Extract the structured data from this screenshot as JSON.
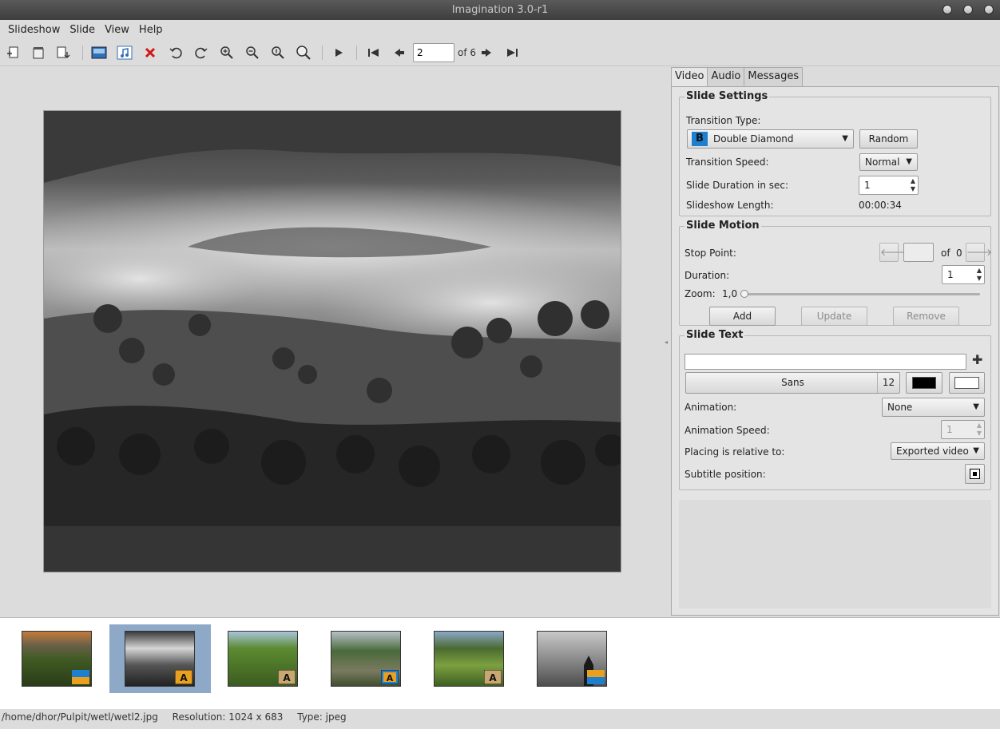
{
  "window": {
    "title": "Imagination 3.0-r1"
  },
  "menu": [
    "Slideshow",
    "Slide",
    "View",
    "Help"
  ],
  "toolbar": {
    "current_slide": "2",
    "of_total": "of 6"
  },
  "tabs": [
    "Video",
    "Audio",
    "Messages"
  ],
  "slide_settings": {
    "title": "Slide Settings",
    "transition_type_label": "Transition Type:",
    "transition_type_value": "Double Diamond",
    "transition_type_badge": "B",
    "random_label": "Random",
    "transition_speed_label": "Transition Speed:",
    "transition_speed_value": "Normal",
    "duration_label": "Slide Duration in sec:",
    "duration_value": "1",
    "length_label": "Slideshow Length:",
    "length_value": "00:00:34"
  },
  "slide_motion": {
    "title": "Slide Motion",
    "stop_point_label": "Stop Point:",
    "of_label": "of",
    "of_value": "0",
    "duration_label": "Duration:",
    "duration_value": "1",
    "zoom_label": "Zoom:",
    "zoom_value": "1,0",
    "add_label": "Add",
    "update_label": "Update",
    "remove_label": "Remove"
  },
  "slide_text": {
    "title": "Slide Text",
    "text_value": "",
    "font_name": "Sans",
    "font_size": "12",
    "animation_label": "Animation:",
    "animation_value": "None",
    "animation_speed_label": "Animation Speed:",
    "animation_speed_value": "1",
    "placing_label": "Placing is relative to:",
    "placing_value": "Exported video",
    "subtitle_position_label": "Subtitle position:"
  },
  "statusbar": {
    "path": "/home/dhor/Pulpit/wetl/wetl2.jpg",
    "resolution": "Resolution: 1024 x 683",
    "type": "Type: jpeg"
  },
  "colors": {
    "selection": "#8ea8c8",
    "accent_blue": "#1e7fd0",
    "badge_orange": "#e8a020"
  }
}
